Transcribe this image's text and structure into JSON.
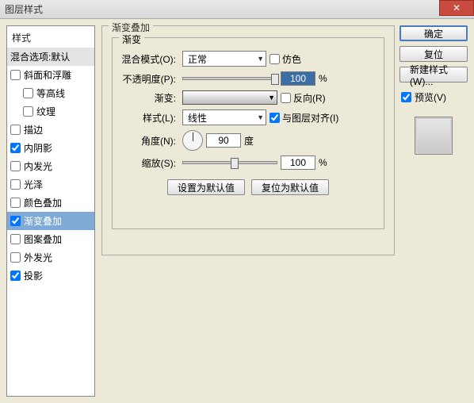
{
  "window": {
    "title": "图层样式"
  },
  "sidebar": {
    "header": "样式",
    "blendOptions": "混合选项:默认",
    "items": [
      {
        "label": "斜面和浮雕",
        "checked": false
      },
      {
        "label": "等高线",
        "checked": false,
        "indent": true
      },
      {
        "label": "纹理",
        "checked": false,
        "indent": true
      },
      {
        "label": "描边",
        "checked": false
      },
      {
        "label": "内阴影",
        "checked": true
      },
      {
        "label": "内发光",
        "checked": false
      },
      {
        "label": "光泽",
        "checked": false
      },
      {
        "label": "颜色叠加",
        "checked": false
      },
      {
        "label": "渐变叠加",
        "checked": true,
        "selected": true
      },
      {
        "label": "图案叠加",
        "checked": false
      },
      {
        "label": "外发光",
        "checked": false
      },
      {
        "label": "投影",
        "checked": true
      }
    ]
  },
  "main": {
    "groupTitle": "渐变叠加",
    "innerTitle": "渐变",
    "blendMode": {
      "label": "混合模式(O):",
      "value": "正常",
      "ditherLabel": "仿色",
      "dither": false
    },
    "opacity": {
      "label": "不透明度(P):",
      "value": "100",
      "unit": "%"
    },
    "gradient": {
      "label": "渐变:",
      "reverseLabel": "反向(R)",
      "reverse": false
    },
    "style": {
      "label": "样式(L):",
      "value": "线性",
      "alignLabel": "与图层对齐(I)",
      "align": true
    },
    "angle": {
      "label": "角度(N):",
      "value": "90",
      "unit": "度"
    },
    "scale": {
      "label": "缩放(S):",
      "value": "100",
      "unit": "%"
    },
    "buttons": {
      "setDefault": "设置为默认值",
      "resetDefault": "复位为默认值"
    }
  },
  "right": {
    "ok": "确定",
    "cancel": "复位",
    "newStyle": "新建样式(W)...",
    "previewLabel": "预览(V)",
    "preview": true
  }
}
